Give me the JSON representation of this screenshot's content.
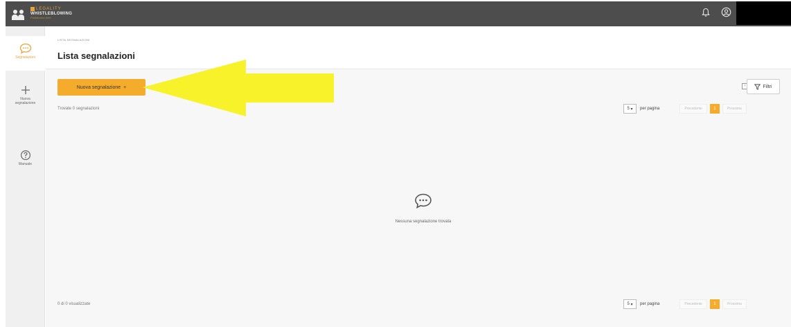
{
  "header": {
    "logo_line1": "LEGALITY",
    "logo_line2": "WHISTLEBLOWING",
    "logo_line3": "Piattaforma Web",
    "icons": [
      "bell-icon",
      "user-circle-icon"
    ]
  },
  "sidebar": {
    "items": [
      {
        "label": "Segnalazioni",
        "icon": "chat-bubble-icon",
        "active": true
      },
      {
        "label": "Nuova segnalazione",
        "icon": "plus-icon",
        "active": false
      },
      {
        "label": "Manuale",
        "icon": "question-circle-icon",
        "active": false
      }
    ]
  },
  "page": {
    "breadcrumb": "LISTA SEGNALAZIONI",
    "title": "Lista segnalazioni"
  },
  "toolbar": {
    "new_button": "Nuova segnalazione",
    "new_button_icon": "+",
    "filters_button": "Filtri",
    "filters_collapse": "‹"
  },
  "results": {
    "found_text": "Trovate 0 segnalazioni",
    "shown_text": "0 di 0 visualizzate",
    "empty_text": "Nessuna segnalazione trovata"
  },
  "pagination": {
    "per_page_value": "5",
    "per_page_label": "per pagina",
    "previous": "Precedente",
    "current_page": "1",
    "next": "Prossima"
  },
  "colors": {
    "accent": "#f5ac2d",
    "topbar": "#4d4d4d",
    "annotation_arrow": "#f7f22a"
  }
}
